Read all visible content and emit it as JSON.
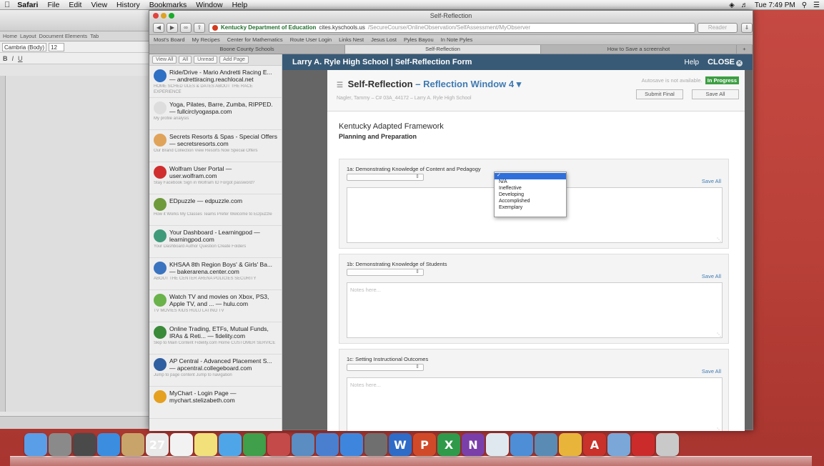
{
  "menubar": {
    "apple": "",
    "items": [
      "Safari",
      "File",
      "Edit",
      "View",
      "History",
      "Bookmarks",
      "Window",
      "Help"
    ],
    "clock": "Tue 7:49 PM"
  },
  "word": {
    "ribbon_tabs": [
      "Home",
      "Layout",
      "Document Elements",
      "Tab"
    ],
    "font_name": "Cambria (Body)",
    "font_size": "12"
  },
  "safari": {
    "window_title": "Self-Reflection",
    "url_site": "Kentucky Department of Education",
    "url_domain": "cites.kyschools.us",
    "url_path": "/SecureCourse/OnlineObservation/SelfAssessment/MyObserver",
    "reader_label": "Reader",
    "bookmarks": [
      "Most's Board",
      "My Recipes",
      "Center for Mathematics",
      "Route User Login",
      "Links Nest",
      "Jesus Lost",
      "Pyles Bayou",
      "In Note Pyles"
    ],
    "tabs": [
      "Boone County Schools",
      "Self-Reflection",
      "How to Save a screenshot"
    ]
  },
  "reading_list": {
    "buttons": [
      "View All",
      "All",
      "Unread",
      "Add Page"
    ],
    "items": [
      {
        "title": "Ride/Drive - Mario Andretti Racing E... — andrettiracing.reachlocal.net",
        "desc": "HOME SCHED ULES & DATES ABOUT THE RACE EXPERIENCE",
        "color": "#2f6fc4"
      },
      {
        "title": "Yoga, Pilates, Barre, Zumba, RIPPED. — fullcirclyogaspa.com",
        "desc": "My profile analysis",
        "color": "#dddddd"
      },
      {
        "title": "Secrets Resorts & Spas - Special Offers — secretsresorts.com",
        "desc": "Our Brand Collection View Resorts Now Special Offers",
        "color": "#e0a35a"
      },
      {
        "title": "Wolfram User Portal — user.wolfram.com",
        "desc": "Stay Facebook Sign in Wolfram ID Forgot password?",
        "color": "#d02e2e"
      },
      {
        "title": "EDpuzzle — edpuzzle.com",
        "desc": "How it Works My Classes Teams Prefer Welcome to EDpuzzle",
        "color": "#6e9a3c"
      },
      {
        "title": "Your Dashboard - Learningpod — learningpod.com",
        "desc": "Your Dashboard Author Question Create Folders",
        "color": "#3f9a7a"
      },
      {
        "title": "KHSAA 8th Region Boys' & Girls' Ba... — bakerarena.center.com",
        "desc": "ABOUT THE CENTER ARENA POLICIES SECURITY",
        "color": "#3a73c0"
      },
      {
        "title": "Watch TV and movies on Xbox, PS3, Apple TV, and ... — hulu.com",
        "desc": "TV MOVIES KIDS HULU LATINO TV",
        "color": "#6ab24a"
      },
      {
        "title": "Online Trading, ETFs, Mutual Funds, IRAs & Reti... — fidelity.com",
        "desc": "Skip to Main Content Fidelity.com Home CUSTOMER SERVICE",
        "color": "#3a8a3a"
      },
      {
        "title": "AP Central - Advanced Placement S... — apcentral.collegeboard.com",
        "desc": "Jump to page content Jump to navigation",
        "color": "#2f5fa0"
      },
      {
        "title": "MyChart - Login Page — mychart.stelizabeth.com",
        "desc": "",
        "color": "#e5a020"
      }
    ]
  },
  "form": {
    "header_title": "Larry A. Ryle High School | Self-Reflection Form",
    "help": "Help",
    "close": "CLOSE",
    "sheet_title": "Self-Reflection",
    "sheet_dash": "–",
    "sheet_window": "Reflection Window 4",
    "sheet_sub": "Nagler, Tammy – C# 03A_44172 – Larry A. Ryle High School",
    "autosave": "Autosave is not available.",
    "status": "In Progress",
    "submit": "Submit Final",
    "save_all": "Save All",
    "framework": "Kentucky Adapted Framework",
    "domain": "Planning and Preparation",
    "sections": [
      {
        "title": "1a:  Demonstrating Knowledge of Content and Pedagogy",
        "save": "Save All",
        "placeholder": ""
      },
      {
        "title": "1b:  Demonstrating Knowledge of Students",
        "save": "Save All",
        "placeholder": "Notes here..."
      },
      {
        "title": "1c:  Setting Instructional Outcomes",
        "save": "Save All",
        "placeholder": "Notes here..."
      }
    ],
    "dropdown_options": [
      "",
      "N/A",
      "Ineffective",
      "Developing",
      "Accomplished",
      "Exemplary"
    ]
  },
  "dock": {
    "icons": [
      "finder-icon",
      "system-preferences-icon",
      "dashboard-icon",
      "safari-icon",
      "photos-icon",
      "calendar-icon",
      "notes-icon",
      "stickies-icon",
      "messages-icon",
      "facetime-icon",
      "photo-booth-icon",
      "iphoto-icon",
      "itunes-icon",
      "app-store-icon",
      "calculator-icon",
      "word-icon",
      "powerpoint-icon",
      "excel-icon",
      "onenote-icon",
      "textedit-icon",
      "preview-icon",
      "finder-alt-icon",
      "chrome-icon",
      "acrobat-icon",
      "mail-icon",
      "pdf-reader-icon",
      "trash-icon"
    ]
  }
}
